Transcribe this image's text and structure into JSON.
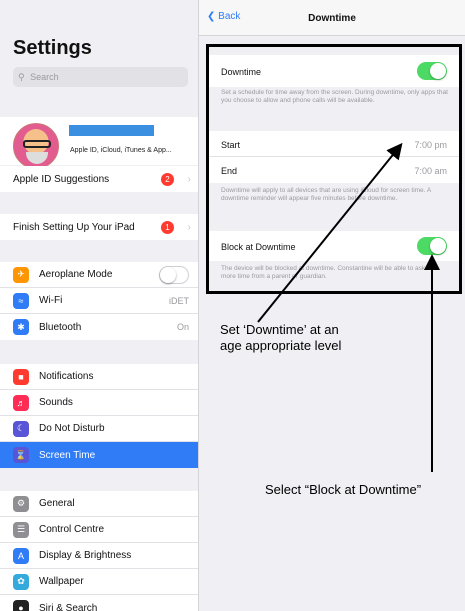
{
  "sidebar": {
    "title": "Settings",
    "search_placeholder": "Search",
    "profile_subtitle": "Apple ID, iCloud, iTunes & App...",
    "apple_id_suggestions": {
      "label": "Apple ID Suggestions",
      "badge": "2"
    },
    "finish_setup": {
      "label": "Finish Setting Up Your iPad",
      "badge": "1"
    },
    "group1": [
      {
        "label": "Aeroplane Mode",
        "icon": "airplane-icon",
        "color": "#ff9500"
      },
      {
        "label": "Wi-Fi",
        "value": "iDET",
        "icon": "wifi-icon",
        "color": "#2f7cf6"
      },
      {
        "label": "Bluetooth",
        "value": "On",
        "icon": "bluetooth-icon",
        "color": "#2f7cf6"
      }
    ],
    "group2": [
      {
        "label": "Notifications",
        "icon": "notifications-icon",
        "color": "#ff3b30"
      },
      {
        "label": "Sounds",
        "icon": "sounds-icon",
        "color": "#ff2d55"
      },
      {
        "label": "Do Not Disturb",
        "icon": "moon-icon",
        "color": "#5856d6"
      },
      {
        "label": "Screen Time",
        "icon": "hourglass-icon",
        "color": "#5856d6"
      }
    ],
    "group3": [
      {
        "label": "General",
        "icon": "gear-icon",
        "color": "#8e8e93"
      },
      {
        "label": "Control Centre",
        "icon": "control-centre-icon",
        "color": "#8e8e93"
      },
      {
        "label": "Display & Brightness",
        "icon": "display-icon",
        "color": "#2f7cf6"
      },
      {
        "label": "Wallpaper",
        "icon": "wallpaper-icon",
        "color": "#34aadc"
      },
      {
        "label": "Siri & Search",
        "icon": "siri-icon",
        "color": "#222222"
      }
    ]
  },
  "detail": {
    "back_label": "Back",
    "title": "Downtime",
    "downtime_label": "Downtime",
    "downtime_note": "Set a schedule for time away from the screen. During downtime, only apps that you choose to allow and phone calls will be available.",
    "start_label": "Start",
    "start_value": "7:00 pm",
    "end_label": "End",
    "end_value": "7:00 am",
    "schedule_note": "Downtime will apply to all devices that are using iCloud for screen time. A downtime reminder will appear five minutes before downtime.",
    "block_label": "Block at Downtime",
    "block_note": "The device will be blocked at downtime. Constantine will be able to ask for more time from a parent or guardian."
  },
  "annotations": {
    "caption_left_line1": "Set ‘Downtime’ at an",
    "caption_left_line2": "age appropriate level",
    "caption_right": "Select “Block at Downtime”"
  },
  "colors": {
    "accent": "#2f7cf6",
    "toggle_on": "#4cd964",
    "badge": "#ff3b30"
  }
}
